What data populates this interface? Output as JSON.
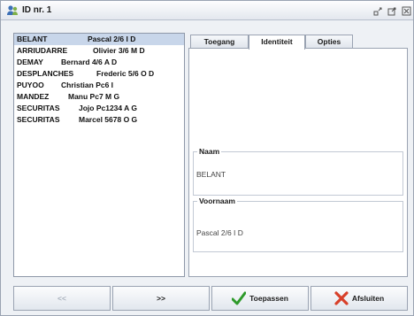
{
  "window": {
    "title": "ID nr. 1",
    "icon": "user-group-icon"
  },
  "list": {
    "items": [
      {
        "last": "BELANT",
        "first": "Pascal 2/6 I D",
        "selected": true
      },
      {
        "last": "ARRIUDARRE",
        "first": "Olivier 3/6 M D",
        "selected": false
      },
      {
        "last": "DEMAY",
        "first": "Bernard 4/6 A D",
        "selected": false
      },
      {
        "last": "DESPLANCHES",
        "first": "Frederic 5/6 O D",
        "selected": false
      },
      {
        "last": "PUYOO",
        "first": "Christian Pc6 I",
        "selected": false
      },
      {
        "last": "MANDEZ",
        "first": "Manu Pc7 M G",
        "selected": false
      },
      {
        "last": "SECURITAS",
        "first": "Jojo Pc1234 A G",
        "selected": false
      },
      {
        "last": "SECURITAS",
        "first": "Marcel 5678 O G",
        "selected": false
      }
    ]
  },
  "tabs": [
    {
      "label": "Toegang",
      "active": false
    },
    {
      "label": "Identiteit",
      "active": true
    },
    {
      "label": "Opties",
      "active": false
    }
  ],
  "form": {
    "naam_label": "Naam",
    "naam_value": "BELANT",
    "voornaam_label": "Voornaam",
    "voornaam_value": "Pascal 2/6 I D"
  },
  "buttons": {
    "prev_label": "<<",
    "next_label": ">>",
    "apply_label": "Toepassen",
    "close_label": "Afsluiten"
  },
  "colors": {
    "selection": "#c8d6ea",
    "apply_check": "#2e9a2a",
    "close_x": "#d8402a"
  }
}
